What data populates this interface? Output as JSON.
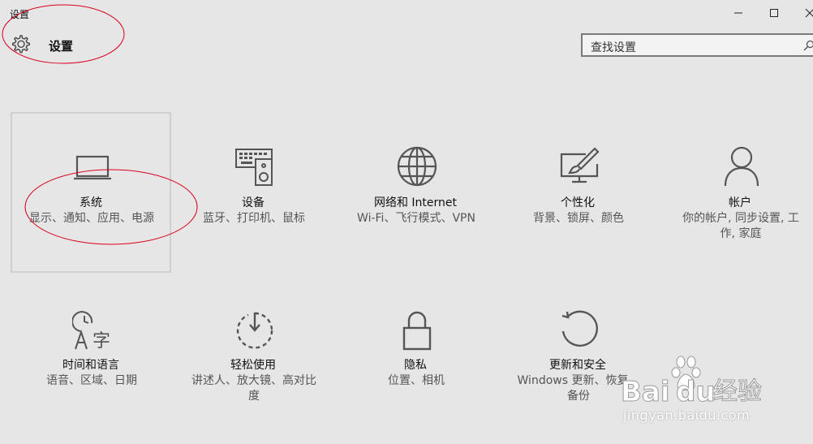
{
  "window": {
    "title": "设置",
    "controls": {
      "minimize_icon": "minimize-icon",
      "maximize_icon": "maximize-icon",
      "close_icon": "close-icon"
    }
  },
  "header": {
    "title": "设置",
    "icon": "gear-icon"
  },
  "search": {
    "placeholder": "查找设置",
    "icon": "search-icon"
  },
  "tiles": [
    {
      "name": "系统",
      "desc": "显示、通知、应用、电源",
      "icon": "laptop-icon",
      "selected": true
    },
    {
      "name": "设备",
      "desc": "蓝牙、打印机、鼠标",
      "icon": "devices-icon"
    },
    {
      "name": "网络和 Internet",
      "desc": "Wi-Fi、飞行模式、VPN",
      "icon": "globe-icon"
    },
    {
      "name": "个性化",
      "desc": "背景、锁屏、颜色",
      "icon": "personalization-icon"
    },
    {
      "name": "帐户",
      "desc": "你的帐户, 同步设置, 工作, 家庭",
      "icon": "person-icon"
    },
    {
      "name": "时间和语言",
      "desc": "语音、区域、日期",
      "icon": "time-language-icon"
    },
    {
      "name": "轻松使用",
      "desc": "讲述人、放大镜、高对比度",
      "icon": "ease-of-access-icon"
    },
    {
      "name": "隐私",
      "desc": "位置、相机",
      "icon": "lock-icon"
    },
    {
      "name": "更新和安全",
      "desc": "Windows 更新、恢复、备份",
      "icon": "update-icon"
    }
  ],
  "watermark": {
    "brand": "Bai经验",
    "url": "jingyan.baidu.com"
  },
  "colors": {
    "background": "#e6e6e6",
    "icon": "#555555",
    "annotation": "#d9001b"
  }
}
